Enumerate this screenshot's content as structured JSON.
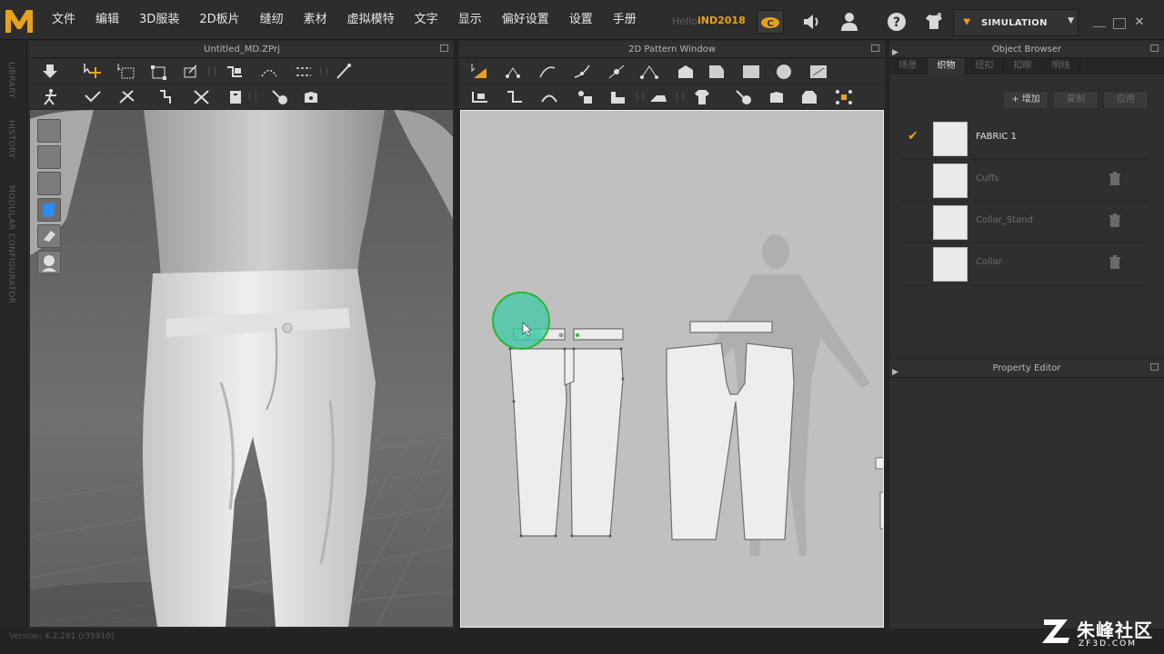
{
  "app": {
    "logo": "MD",
    "menu": [
      "文件",
      "编辑",
      "3D服装",
      "2D板片",
      "缝纫",
      "素材",
      "虚拟模特",
      "文字",
      "显示",
      "偏好设置",
      "设置",
      "手册"
    ],
    "user_greeting": "Hello",
    "user_name": "iND2018",
    "simulation_label": "SIMULATION",
    "side_tabs": [
      "LIBRARY",
      "HISTORY",
      "MODULAR CONFIGURATOR"
    ]
  },
  "viewport3d": {
    "title": "Untitled_MD.ZPrj"
  },
  "pattern2d": {
    "title": "2D Pattern Window"
  },
  "object_browser": {
    "title": "Object Browser",
    "tabs": [
      "场景",
      "织物",
      "纽扣",
      "扣眼",
      "明线"
    ],
    "active_tab": 1,
    "add_button": "+ 增加",
    "copy_button": "复制",
    "apply_button": "应用",
    "fabrics": [
      {
        "name": "FABRIC 1",
        "active": true
      },
      {
        "name": "Cuffs",
        "active": false
      },
      {
        "name": "Collar_Stand",
        "active": false
      },
      {
        "name": "Collar",
        "active": false
      }
    ]
  },
  "property_editor": {
    "title": "Property Editor"
  },
  "status": {
    "version": "Version: 4.2.281 (r35910)"
  },
  "watermark": {
    "text": "朱峰社区",
    "sub": "ZF3D.COM"
  },
  "colors": {
    "accent": "#e8a21a",
    "cursor_highlight": "#3ec9a8"
  }
}
